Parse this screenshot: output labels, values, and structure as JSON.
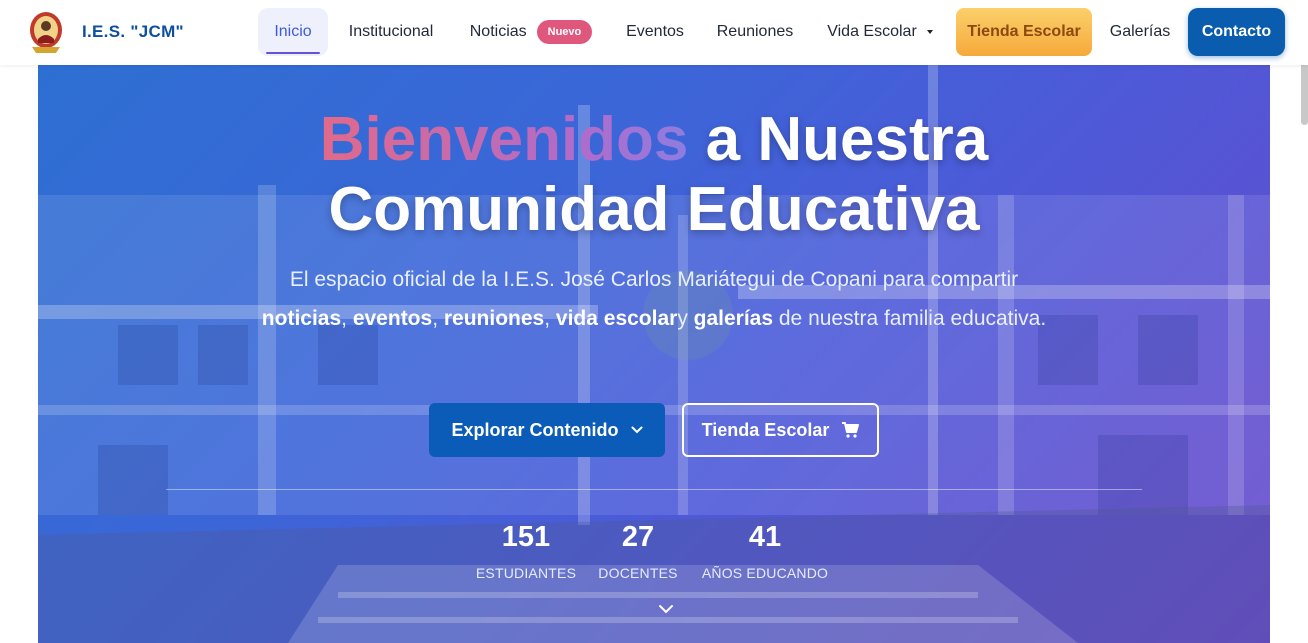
{
  "brand": {
    "name": "I.E.S. \"JCM\""
  },
  "nav": {
    "items": [
      {
        "label": "Inicio"
      },
      {
        "label": "Institucional"
      },
      {
        "label": "Noticias",
        "badge": "Nuevo"
      },
      {
        "label": "Eventos"
      },
      {
        "label": "Reuniones"
      },
      {
        "label": "Vida Escolar"
      },
      {
        "label": "Tienda Escolar"
      },
      {
        "label": "Galerías"
      },
      {
        "label": "Contacto"
      }
    ]
  },
  "hero": {
    "title_highlight": "Bienvenidos",
    "title_rest_line1": " a Nuestra",
    "title_line2": "Comunidad Educativa",
    "subtitle_part1": "El espacio oficial de la I.E.S. José Carlos Mariátegui de Copani para compartir ",
    "subtitle_kw1": "noticias",
    "subtitle_sep1": ", ",
    "subtitle_kw2": "eventos",
    "subtitle_sep2": ", ",
    "subtitle_kw3": "reuniones",
    "subtitle_sep3": ", ",
    "subtitle_kw4": "vida escolar",
    "subtitle_sep4": "y ",
    "subtitle_kw5": "galerías",
    "subtitle_part2": " de nuestra familia educativa.",
    "cta_primary": "Explorar Contenido",
    "cta_secondary": "Tienda Escolar"
  },
  "stats": [
    {
      "value": "151",
      "label": "ESTUDIANTES"
    },
    {
      "value": "27",
      "label": "DOCENTES"
    },
    {
      "value": "41",
      "label": "AÑOS EDUCANDO"
    }
  ],
  "colors": {
    "brand_blue": "#0d4f9e",
    "accent_orange": "#f6a93b",
    "badge_pink": "#e0577e",
    "hero_gradient_start": "#2e6fd2",
    "hero_gradient_end": "#6a48cc"
  }
}
